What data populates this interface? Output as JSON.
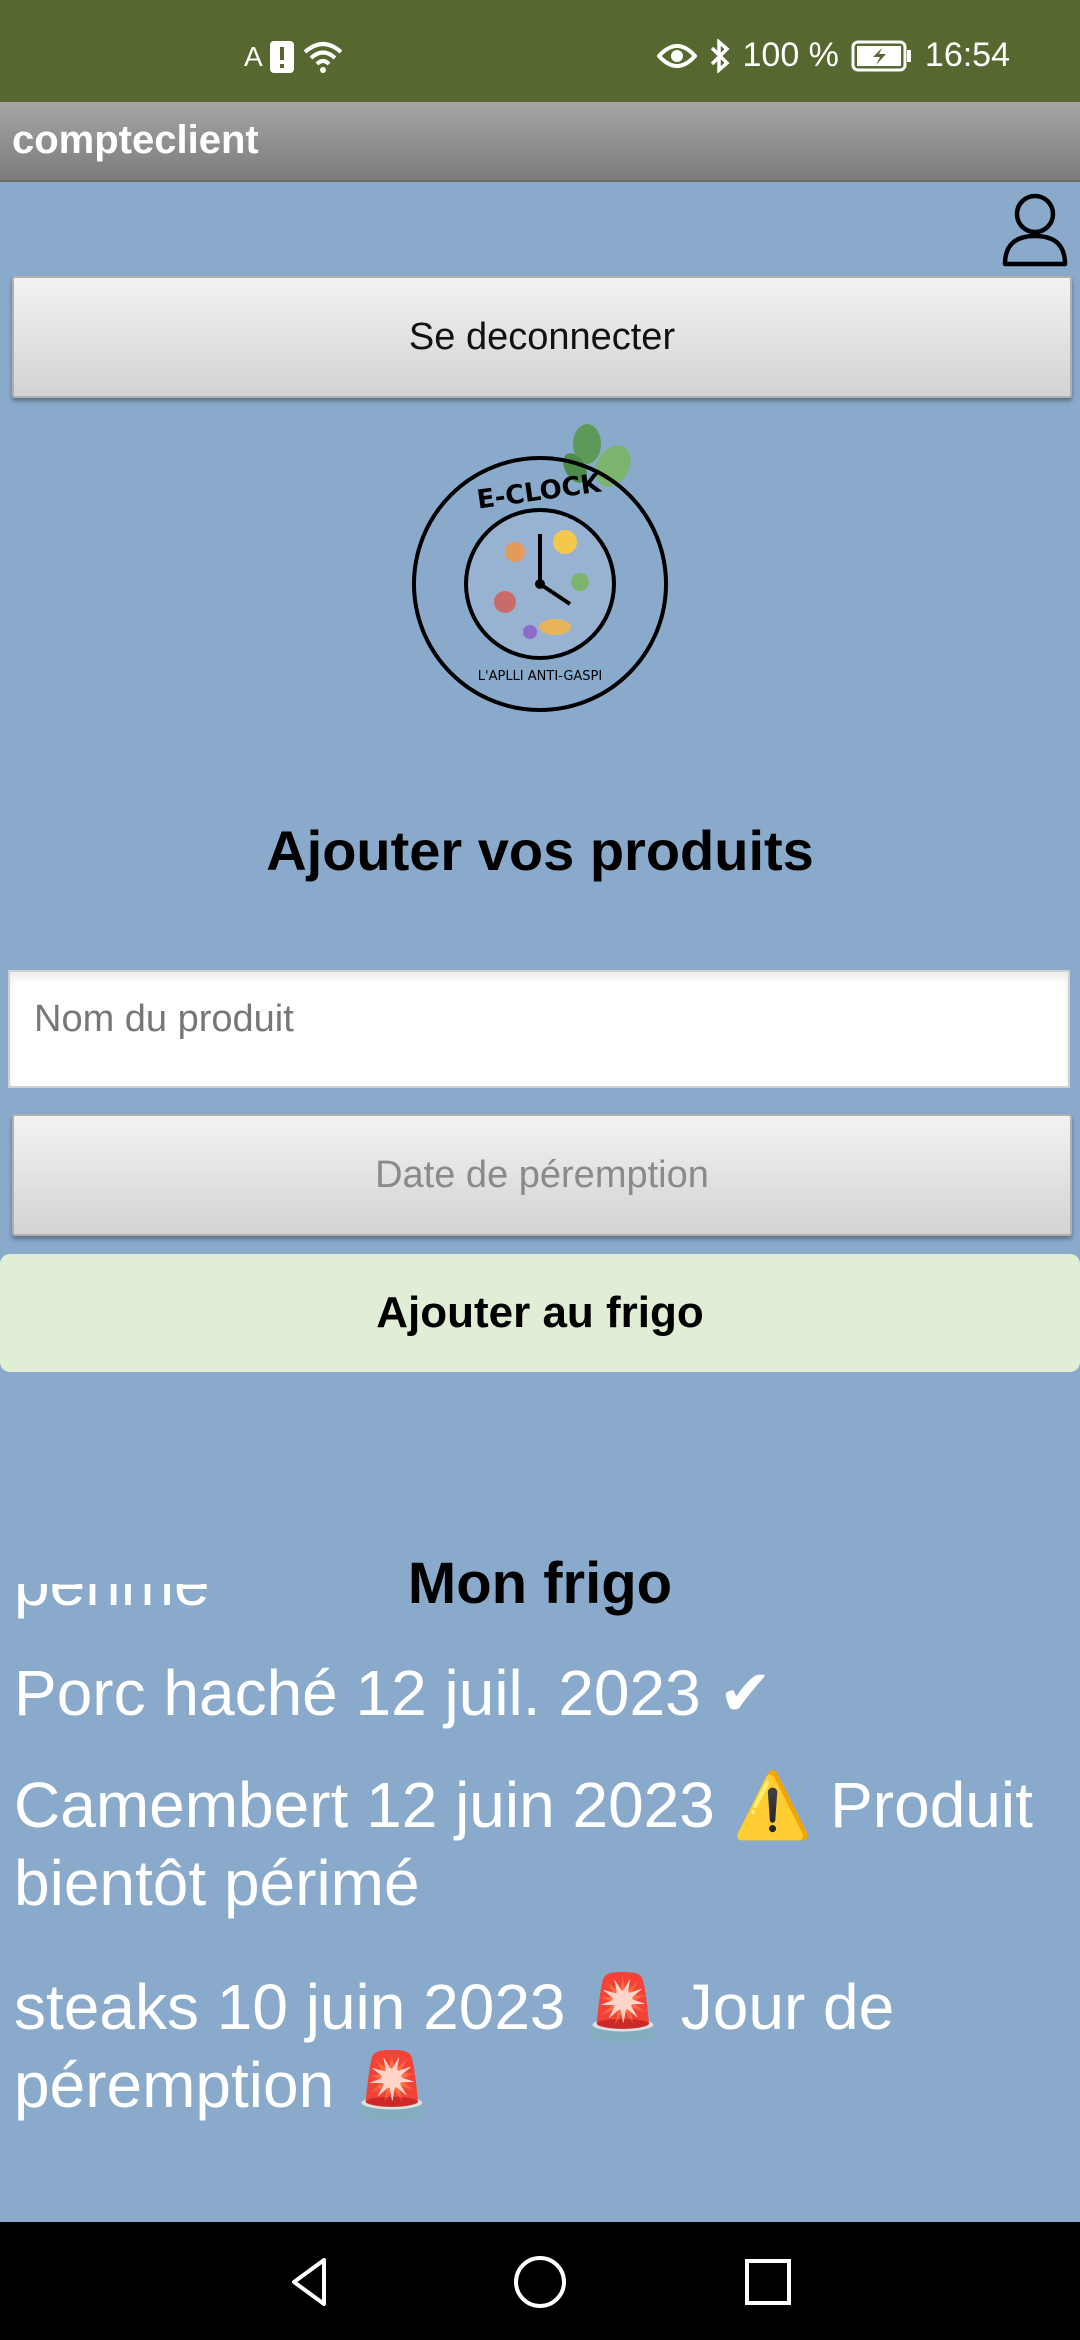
{
  "status_bar": {
    "left_indicators": "A",
    "battery_percent": "100 %",
    "time": "16:54"
  },
  "app": {
    "title": "compteclient"
  },
  "colors": {
    "status_bar": "#56672F",
    "background": "#8AAACC",
    "add_button": "#E0EED5"
  },
  "account": {
    "logout_label": "Se deconnecter"
  },
  "logo": {
    "top_text": "E-CLOCK",
    "bottom_text": "L'APLLI ANTI-GASPI"
  },
  "add_section": {
    "heading": "Ajouter vos produits",
    "product_name_placeholder": "Nom du produit",
    "expiry_date_label": "Date de péremption",
    "add_button_label": "Ajouter au frigo"
  },
  "fridge": {
    "heading": "Mon frigo",
    "items": [
      {
        "text": "périmé"
      },
      {
        "text": "Porc haché   12 juil. 2023     ✔"
      },
      {
        "text": "Camembert   12 juin 2023    ⚠️ Produit bientôt périmé"
      },
      {
        "text": "steaks   10 juin 2023    🚨 Jour de péremption 🚨"
      }
    ]
  },
  "nav": {
    "back": "back-icon",
    "home": "home-icon",
    "recents": "recents-icon"
  }
}
